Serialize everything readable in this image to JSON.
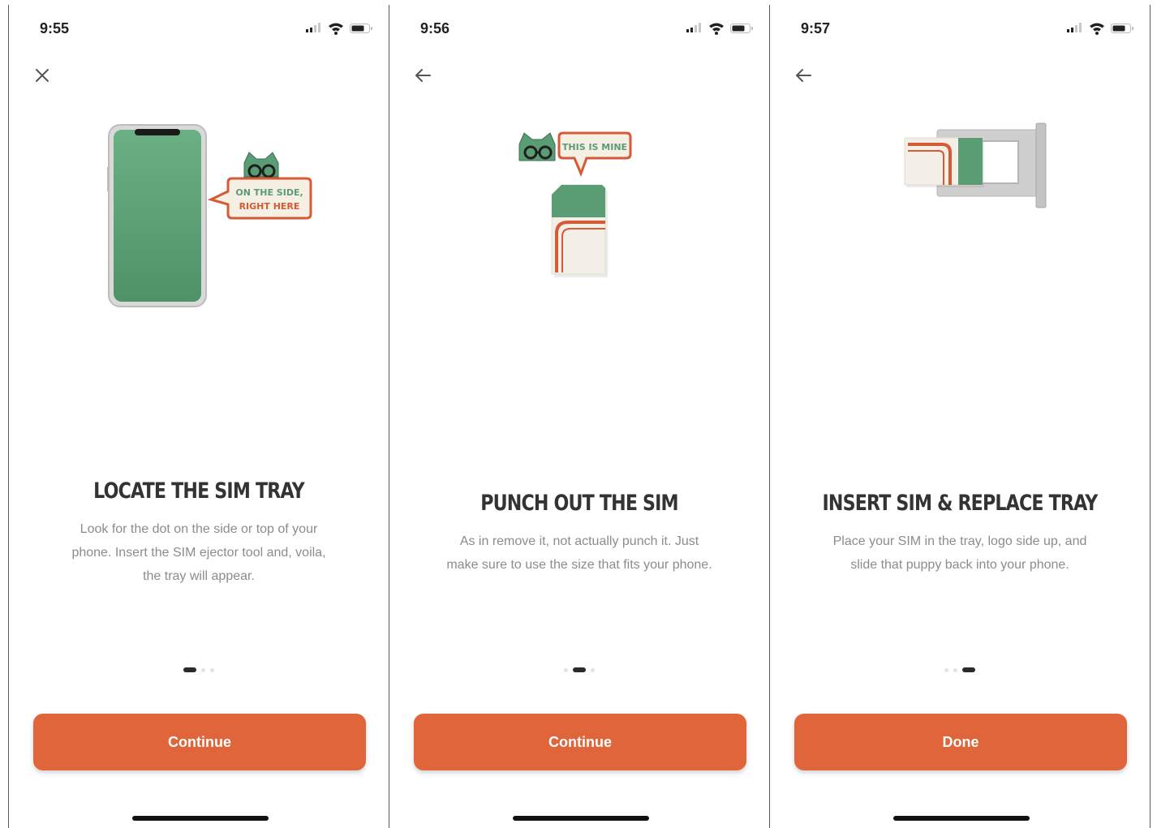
{
  "colors": {
    "accent": "#e0653a",
    "phone_green": "#5a9c73",
    "text_heading": "#333333",
    "text_body": "#8c8c8c"
  },
  "status_icons": [
    "cellular-signal-icon",
    "wifi-icon",
    "battery-icon"
  ],
  "screens": [
    {
      "time": "9:55",
      "nav_icon": "close-icon",
      "speech_bubble_lines": [
        "ON THE SIDE,",
        "RIGHT HERE"
      ],
      "title": "LOCATE THE SIM TRAY",
      "body_lines": [
        "Look for the dot on the side or top of your",
        "phone. Insert the SIM ejector tool and, voila,",
        "the tray will appear."
      ],
      "page_index": 1,
      "page_count": 3,
      "cta_label": "Continue"
    },
    {
      "time": "9:56",
      "nav_icon": "back-arrow-icon",
      "speech_bubble_lines": [
        "THIS IS MINE"
      ],
      "title": "PUNCH OUT THE SIM",
      "body_lines": [
        "As in remove it, not actually punch it. Just",
        "make sure to use the size that fits your phone."
      ],
      "page_index": 2,
      "page_count": 3,
      "cta_label": "Continue"
    },
    {
      "time": "9:57",
      "nav_icon": "back-arrow-icon",
      "title": "INSERT SIM & REPLACE TRAY",
      "body_lines": [
        "Place your SIM in the tray, logo side up, and",
        "slide that puppy back into your phone."
      ],
      "page_index": 3,
      "page_count": 3,
      "cta_label": "Done"
    }
  ]
}
